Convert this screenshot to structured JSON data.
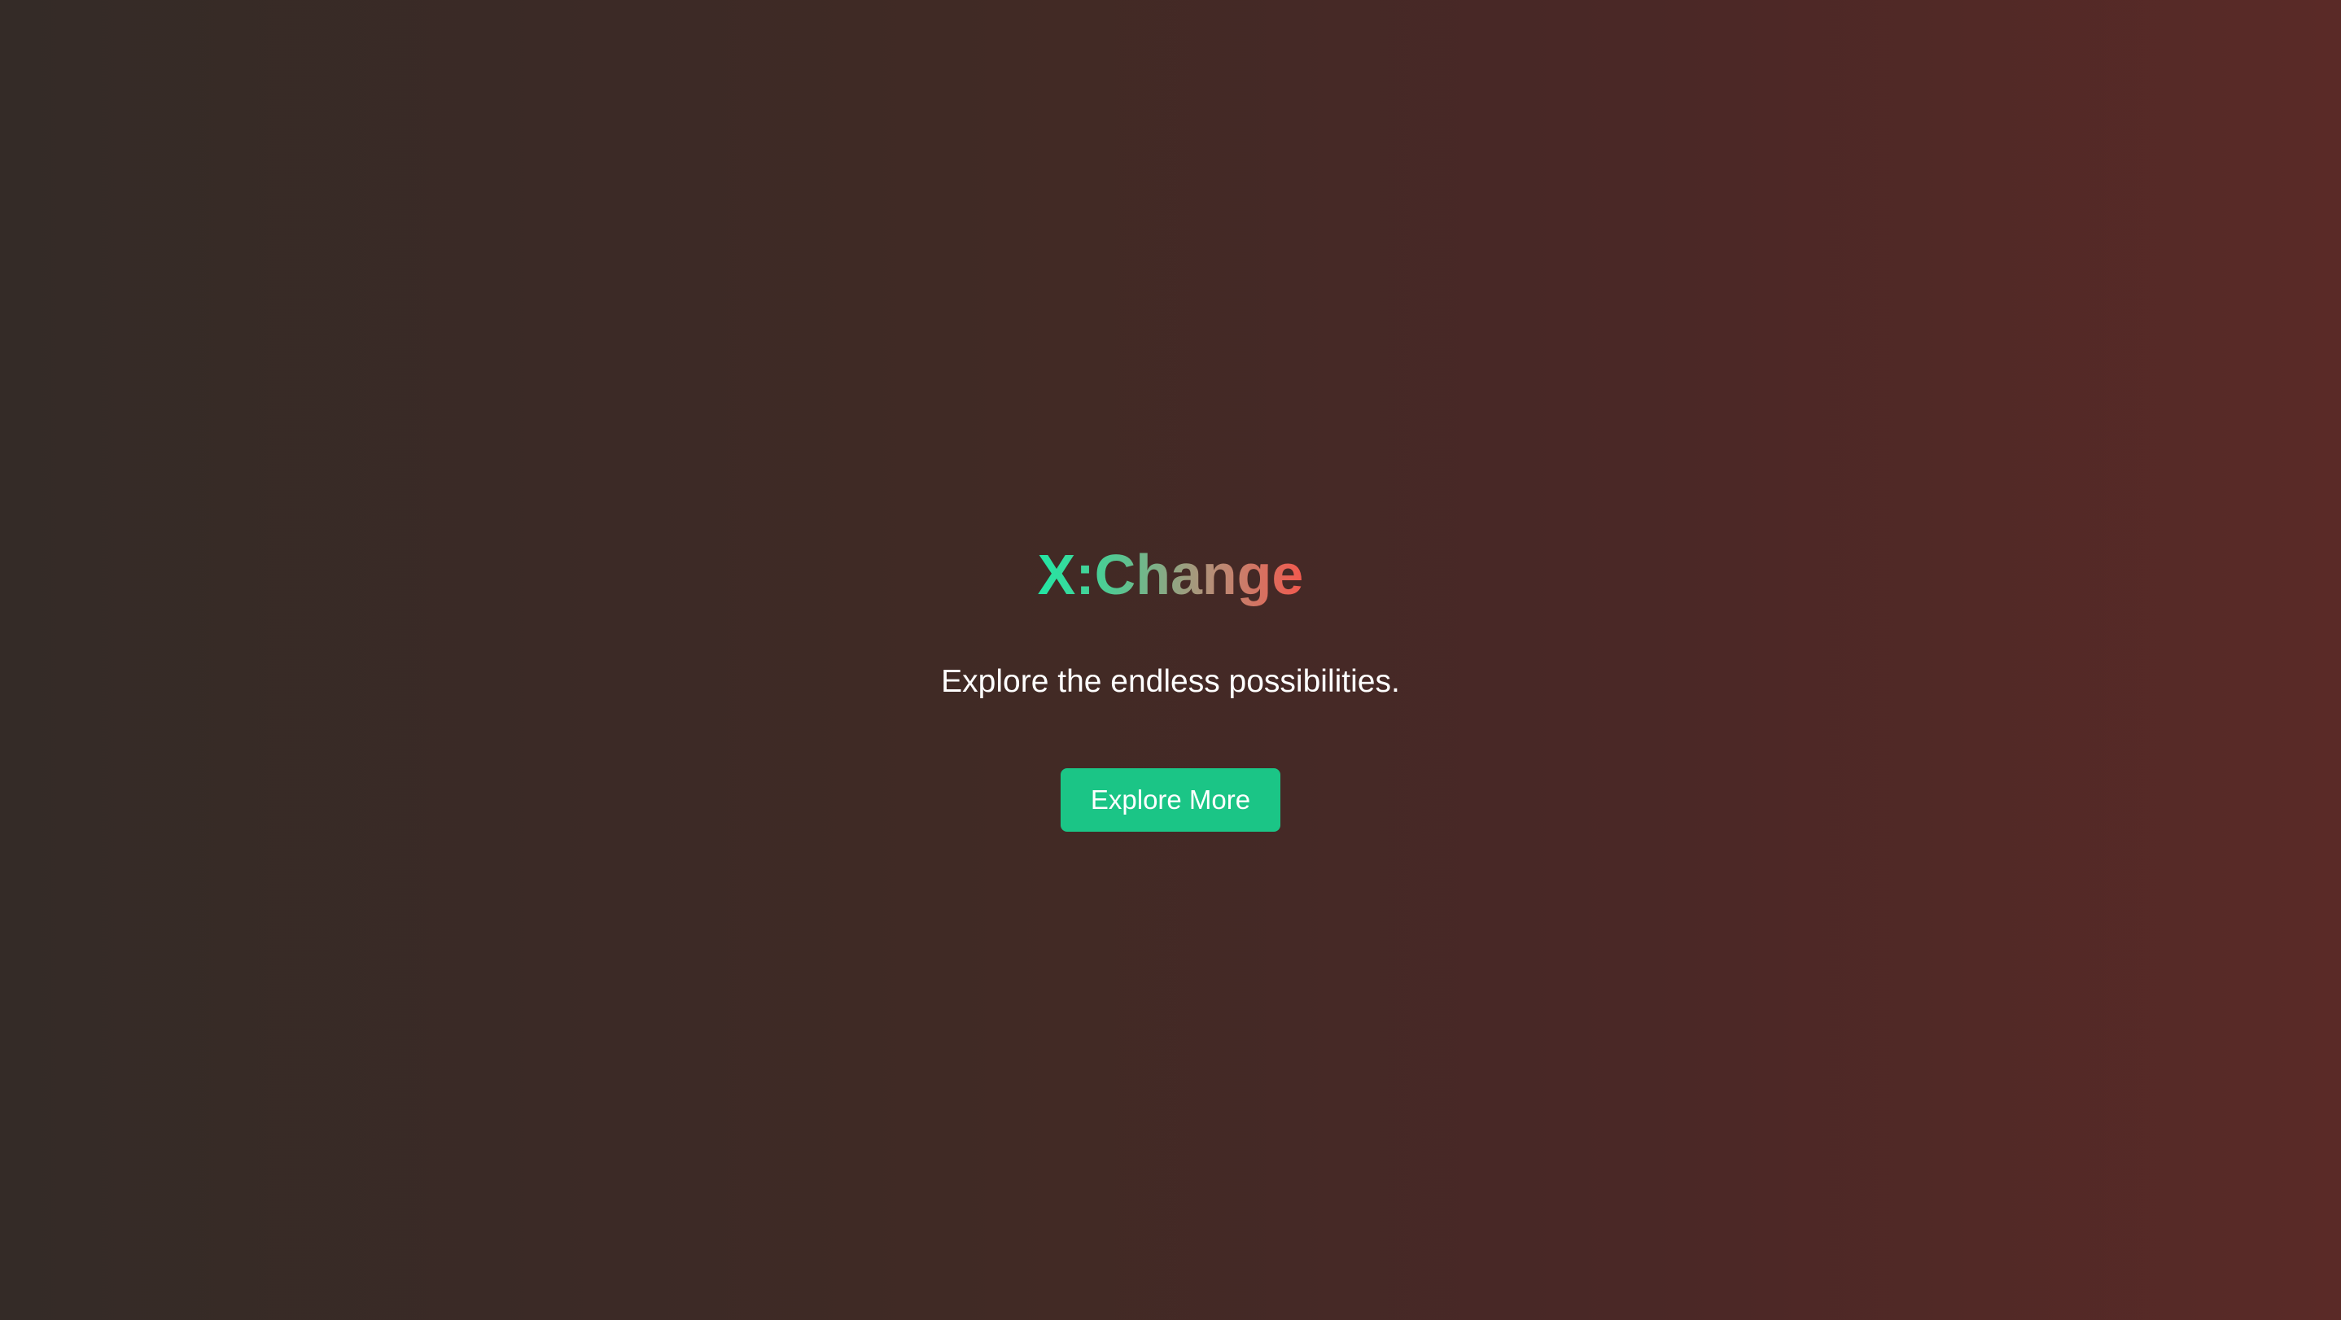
{
  "hero": {
    "title": "X:Change",
    "subtitle": "Explore the endless possibilities.",
    "button_label": "Explore More"
  },
  "colors": {
    "title_gradient_start": "#22e6a4",
    "title_gradient_end": "#f2594e",
    "button_background": "#1bc586",
    "background_left": "#342b27",
    "background_right": "#5a2a27"
  }
}
